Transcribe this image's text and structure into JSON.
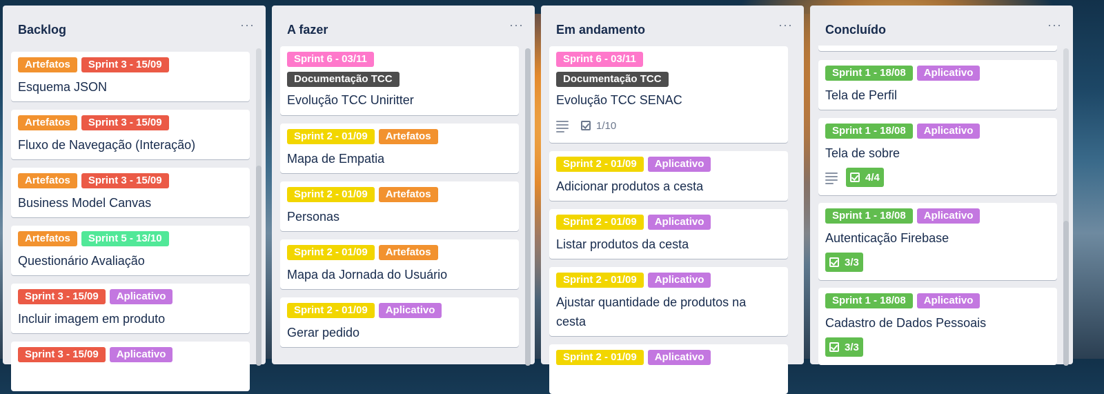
{
  "colors": {
    "orange": "#f2922f",
    "red": "#eb5a46",
    "mint": "#51e898",
    "purple": "#c377e0",
    "pink": "#ff78cb",
    "dark": "#4d4d4d",
    "yellow": "#f2d600",
    "green": "#61bd4f"
  },
  "lists": [
    {
      "title": "Backlog",
      "menu": "···",
      "cards": [
        {
          "labels": [
            {
              "text": "Artefatos",
              "color": "orange"
            },
            {
              "text": "Sprint 3 - 15/09",
              "color": "red"
            }
          ],
          "title": "Esquema JSON"
        },
        {
          "labels": [
            {
              "text": "Artefatos",
              "color": "orange"
            },
            {
              "text": "Sprint 3 - 15/09",
              "color": "red"
            }
          ],
          "title": "Fluxo de Navegação (Interação)"
        },
        {
          "labels": [
            {
              "text": "Artefatos",
              "color": "orange"
            },
            {
              "text": "Sprint 3 - 15/09",
              "color": "red"
            }
          ],
          "title": "Business Model Canvas"
        },
        {
          "labels": [
            {
              "text": "Artefatos",
              "color": "orange"
            },
            {
              "text": "Sprint 5 - 13/10",
              "color": "mint"
            }
          ],
          "title": "Questionário Avaliação"
        },
        {
          "labels": [
            {
              "text": "Sprint 3 - 15/09",
              "color": "red"
            },
            {
              "text": "Aplicativo",
              "color": "purple"
            }
          ],
          "title": "Incluir imagem em produto"
        },
        {
          "labels": [
            {
              "text": "Sprint 3 - 15/09",
              "color": "red"
            },
            {
              "text": "Aplicativo",
              "color": "purple"
            }
          ],
          "title": ""
        }
      ]
    },
    {
      "title": "A fazer",
      "menu": "···",
      "cards": [
        {
          "labels": [
            {
              "text": "Sprint 6 - 03/11",
              "color": "pink"
            }
          ],
          "labels2": [
            {
              "text": "Documentação TCC",
              "color": "dark"
            }
          ],
          "title": "Evolução TCC Uniritter"
        },
        {
          "labels": [
            {
              "text": "Sprint 2 - 01/09",
              "color": "yellow"
            },
            {
              "text": "Artefatos",
              "color": "orange"
            }
          ],
          "title": "Mapa de Empatia"
        },
        {
          "labels": [
            {
              "text": "Sprint 2 - 01/09",
              "color": "yellow"
            },
            {
              "text": "Artefatos",
              "color": "orange"
            }
          ],
          "title": "Personas"
        },
        {
          "labels": [
            {
              "text": "Sprint 2 - 01/09",
              "color": "yellow"
            },
            {
              "text": "Artefatos",
              "color": "orange"
            }
          ],
          "title": "Mapa da Jornada do Usuário"
        },
        {
          "labels": [
            {
              "text": "Sprint 2 - 01/09",
              "color": "yellow"
            },
            {
              "text": "Aplicativo",
              "color": "purple"
            }
          ],
          "title": "Gerar pedido"
        }
      ]
    },
    {
      "title": "Em andamento",
      "menu": "···",
      "cards": [
        {
          "labels": [
            {
              "text": "Sprint 6 - 03/11",
              "color": "pink"
            }
          ],
          "labels2": [
            {
              "text": "Documentação TCC",
              "color": "dark"
            }
          ],
          "title": "Evolução TCC SENAC",
          "checklist": "1/10",
          "checklist_done": false,
          "has_description": true
        },
        {
          "labels": [
            {
              "text": "Sprint 2 - 01/09",
              "color": "yellow"
            },
            {
              "text": "Aplicativo",
              "color": "purple"
            }
          ],
          "title": "Adicionar produtos a cesta"
        },
        {
          "labels": [
            {
              "text": "Sprint 2 - 01/09",
              "color": "yellow"
            },
            {
              "text": "Aplicativo",
              "color": "purple"
            }
          ],
          "title": "Listar produtos da cesta"
        },
        {
          "labels": [
            {
              "text": "Sprint 2 - 01/09",
              "color": "yellow"
            },
            {
              "text": "Aplicativo",
              "color": "purple"
            }
          ],
          "title": "Ajustar quantidade de produtos na",
          "title2": "cesta"
        },
        {
          "labels": [
            {
              "text": "Sprint 2 - 01/09",
              "color": "yellow"
            },
            {
              "text": "Aplicativo",
              "color": "purple"
            }
          ],
          "title": ""
        }
      ]
    },
    {
      "title": "Concluído",
      "menu": "···",
      "cards": [
        {
          "labels": [],
          "title": ""
        },
        {
          "labels": [
            {
              "text": "Sprint 1 - 18/08",
              "color": "green"
            },
            {
              "text": "Aplicativo",
              "color": "purple"
            }
          ],
          "title": "Tela de Perfil"
        },
        {
          "labels": [
            {
              "text": "Sprint 1 - 18/08",
              "color": "green"
            },
            {
              "text": "Aplicativo",
              "color": "purple"
            }
          ],
          "title": "Tela de sobre",
          "checklist": "4/4",
          "checklist_done": true,
          "has_description": true
        },
        {
          "labels": [
            {
              "text": "Sprint 1 - 18/08",
              "color": "green"
            },
            {
              "text": "Aplicativo",
              "color": "purple"
            }
          ],
          "title": "Autenticação Firebase",
          "checklist": "3/3",
          "checklist_done": true
        },
        {
          "labels": [
            {
              "text": "Sprint 1 - 18/08",
              "color": "green"
            },
            {
              "text": "Aplicativo",
              "color": "purple"
            }
          ],
          "title": "Cadastro de Dados Pessoais",
          "checklist": "3/3",
          "checklist_done": true
        }
      ]
    }
  ]
}
